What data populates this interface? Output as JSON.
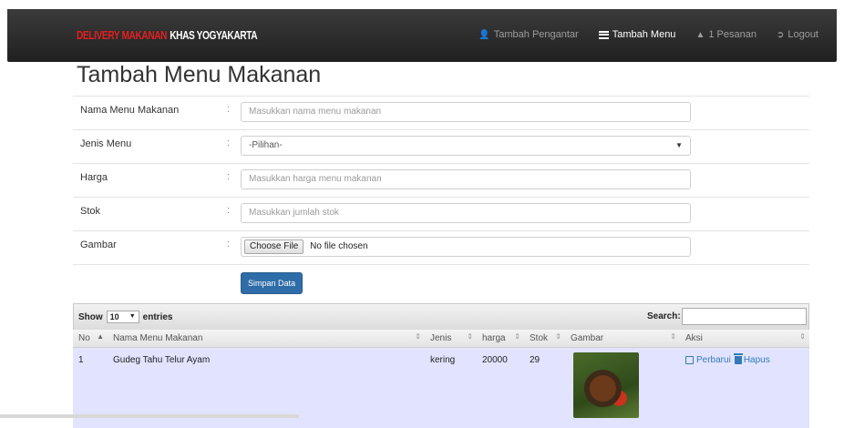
{
  "navbar": {
    "brand_red": "DELIVERY MAKANAN",
    "brand_white": "KHAS YOGYAKARTA",
    "links": [
      {
        "label": "Tambah Pengantar",
        "icon": "user-icon"
      },
      {
        "label": "Tambah Menu",
        "icon": "list-icon",
        "active": true
      },
      {
        "label": "1 Pesanan",
        "icon": "bell-icon"
      },
      {
        "label": "Logout",
        "icon": "logout-icon"
      }
    ]
  },
  "page_title": "Tambah Menu Makanan",
  "form": {
    "separator": ":",
    "fields": [
      {
        "label": "Nama Menu Makanan",
        "placeholder": "Masukkan nama menu makanan"
      },
      {
        "label": "Jenis Menu",
        "value": "-Pilihan-"
      },
      {
        "label": "Harga",
        "placeholder": "Masukkan harga menu makanan"
      },
      {
        "label": "Stok",
        "placeholder": "Masukkan jumlah stok"
      },
      {
        "label": "Gambar",
        "button": "Choose File",
        "status": "No file chosen"
      }
    ],
    "submit": "Simpan Data"
  },
  "table": {
    "show_label": "Show",
    "entries_value": "10",
    "entries_label": "entries",
    "search_label": "Search:",
    "columns": [
      "No",
      "Nama Menu Makanan",
      "Jenis",
      "harga",
      "Stok",
      "Gambar",
      "Aksi"
    ],
    "rows": [
      {
        "no": "1",
        "nama": "Gudeg Tahu Telur Ayam",
        "jenis": "kering",
        "harga": "20000",
        "stok": "29",
        "edit": "Perbarui",
        "delete": "Hapus"
      }
    ]
  },
  "colors": {
    "navbar": "#222222",
    "brand_red": "#e02020",
    "primary": "#2f6da8",
    "row_highlight": "#e2e4ff",
    "link": "#337ab7"
  }
}
